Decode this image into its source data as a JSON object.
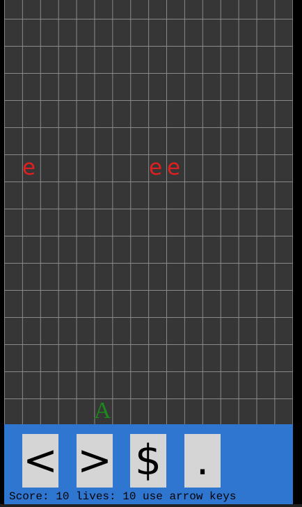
{
  "board": {
    "enemies": [
      "e",
      "e",
      "e"
    ],
    "player": "A"
  },
  "controls": {
    "left_label": "<",
    "right_label": ">",
    "shop_label": "$",
    "dot_label": "."
  },
  "status": {
    "text": "Score: 10 lives: 10 use arrow keys",
    "score": 10,
    "lives": 10
  },
  "colors": {
    "board_bg": "#363636",
    "grid_line": "#8a8a8a",
    "enemy": "#e02020",
    "player": "#1b8a1b",
    "panel": "#2f76d0",
    "button": "#d5d5d5"
  }
}
